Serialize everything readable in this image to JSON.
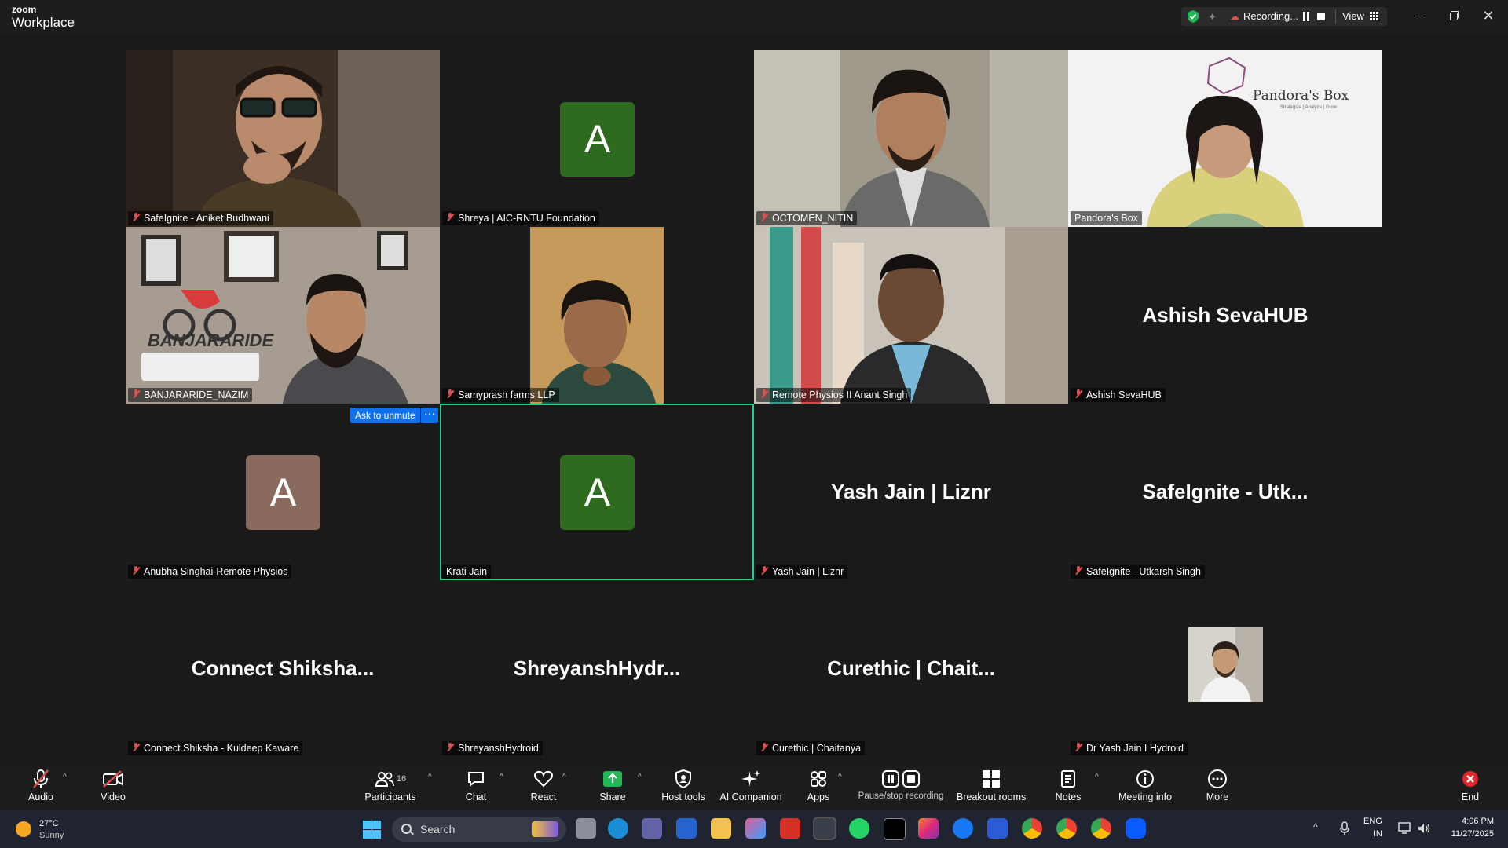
{
  "app": {
    "brand_top": "zoom",
    "brand_bottom": "Workplace"
  },
  "recording": {
    "label": "Recording...",
    "view_label": "View"
  },
  "tiles": [
    {
      "name": "SafeIgnite - Aniket Budhwani",
      "type": "video",
      "muted": true
    },
    {
      "name": "Shreya | AIC-RNTU Foundation",
      "type": "avatar",
      "initial": "A",
      "color": "#2e6b1f",
      "muted": true
    },
    {
      "name": "OCTOMEN_NITIN",
      "type": "video",
      "muted": true
    },
    {
      "name": "Pandora's Box",
      "type": "video",
      "muted": false,
      "logo_text": "Pandora's Box",
      "logo_sub": "Strategize | Analyze | Grow"
    },
    {
      "name": "BANJARARIDE_NAZIM",
      "type": "video",
      "muted": true,
      "logo_text": "BANJARARIDE"
    },
    {
      "name": "Samyprash farms LLP",
      "type": "video",
      "muted": true
    },
    {
      "name": "Remote Physios II Anant Singh",
      "type": "video",
      "muted": true
    },
    {
      "name": "Ashish SevaHUB",
      "type": "text",
      "display": "Ashish SevaHUB",
      "muted": true
    },
    {
      "name": "Anubha Singhai-Remote Physios",
      "type": "avatar",
      "initial": "A",
      "color": "#8a6a5c",
      "muted": true
    },
    {
      "name": "Krati Jain",
      "type": "avatar",
      "initial": "A",
      "color": "#2e6b1f",
      "muted": false,
      "active": true
    },
    {
      "name": "Yash Jain | Liznr",
      "type": "text",
      "display": "Yash Jain | Liznr",
      "muted": true
    },
    {
      "name": "SafeIgnite - Utkarsh Singh",
      "type": "text",
      "display": "SafeIgnite - Utk...",
      "muted": true
    },
    {
      "name": "Connect Shiksha - Kuldeep Kaware",
      "type": "text",
      "display": "Connect  Shiksha...",
      "muted": true
    },
    {
      "name": "ShreyanshHydroid",
      "type": "text",
      "display": "ShreyanshHydr...",
      "muted": true
    },
    {
      "name": "Curethic | Chaitanya",
      "type": "text",
      "display": "Curethic | Chait...",
      "muted": true
    },
    {
      "name": "Dr Yash Jain I Hydroid",
      "type": "photo",
      "muted": true
    }
  ],
  "ask_unmute": "Ask to unmute",
  "toolbar": {
    "audio": "Audio",
    "video": "Video",
    "participants": "Participants",
    "participants_count": "16",
    "chat": "Chat",
    "react": "React",
    "share": "Share",
    "host_tools": "Host tools",
    "ai_companion": "AI Companion",
    "apps": "Apps",
    "pause_rec": "Pause/stop recording",
    "breakout": "Breakout rooms",
    "notes": "Notes",
    "meeting_info": "Meeting info",
    "more": "More",
    "end": "End"
  },
  "taskbar": {
    "temperature": "27°C",
    "weather": "Sunny",
    "search": "Search",
    "lang1": "ENG",
    "lang2": "IN",
    "time": "4:06 PM",
    "date": "11/27/2025"
  }
}
